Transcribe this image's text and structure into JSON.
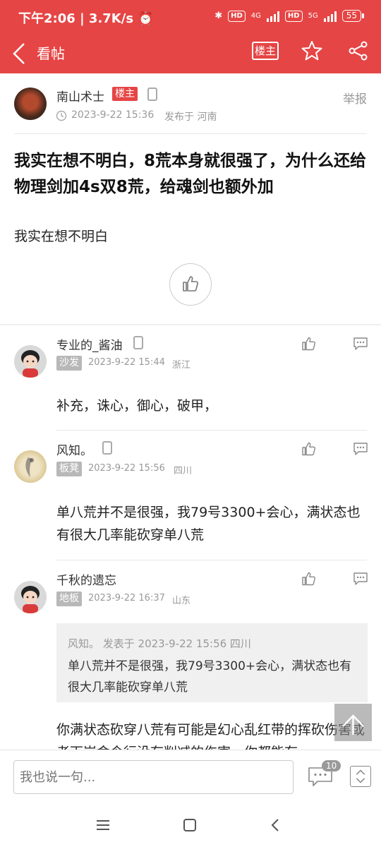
{
  "status_bar": {
    "time": "下午2:06",
    "speed": "3.7K/s",
    "net1": "4G",
    "net2": "5G",
    "hd": "HD",
    "battery": "55"
  },
  "header": {
    "title": "看帖",
    "host_label": "楼主",
    "icons": [
      "back-icon",
      "star-icon",
      "share-icon"
    ],
    "color": "#e64545"
  },
  "post": {
    "author": "南山术士",
    "author_badge": "楼主",
    "time": "2023-9-22 15:36",
    "location": "发布于 河南",
    "report": "举报",
    "title": "我实在想不明白，8荒本身就很强了，为什么还给物理剑加4s双8荒，给魂剑也额外加",
    "body": "我实在想不明白"
  },
  "replies": [
    {
      "name": "专业的_酱油",
      "floor": "沙发",
      "time": "2023-9-22 15:44",
      "location": "浙江",
      "text": "补充，诛心，御心，破甲，"
    },
    {
      "name": "风知。",
      "floor": "板凳",
      "time": "2023-9-22 15:56",
      "location": "四川",
      "text": "单八荒并不是很强，我79号3300+会心，满状态也有很大几率能砍穿单八荒"
    },
    {
      "name": "千秋的遗忘",
      "floor": "地板",
      "time": "2023-9-22 16:37",
      "location": "山东",
      "quote_meta": "风知。 发表于 2023-9-22 15:56 四川",
      "quote_text": "单八荒并不是很强，我79号3300+会心，满状态也有很大几率能砍穿单八荒",
      "text": "你满状态砍穿八荒有可能是幻心乱红带的挥砍伤害或者下岗命令行没有削减的伤害，你都能有"
    }
  ],
  "bottom_bar": {
    "input_placeholder": "我也说一句...",
    "comment_count": "10"
  }
}
